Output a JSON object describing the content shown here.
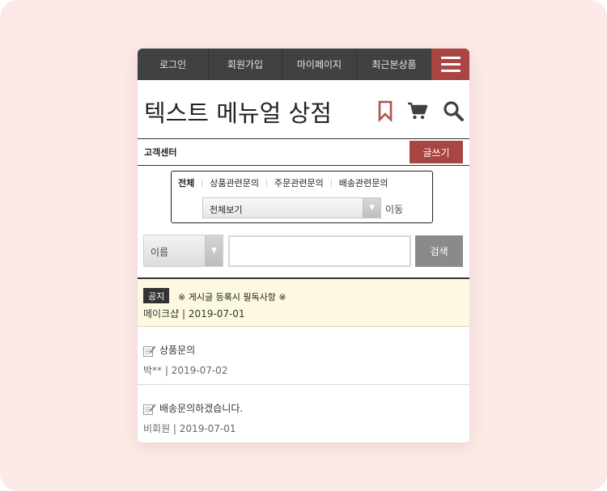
{
  "topnav": {
    "items": [
      "로그인",
      "회원가입",
      "마이페이지",
      "최근본상품"
    ]
  },
  "header": {
    "shop_title": "텍스트 메뉴얼 상점",
    "icons": [
      "bookmark-icon",
      "cart-icon",
      "search-icon"
    ],
    "accent_color": "#a94543"
  },
  "board": {
    "section_label": "고객센터",
    "write_label": "글쓰기",
    "categories": [
      "전체",
      "상품관련문의",
      "주문관련문의",
      "배송관련문의"
    ],
    "board_select": "전체보기",
    "move_label": "이동"
  },
  "search": {
    "field_value": "이름",
    "query": "",
    "button_label": "검색"
  },
  "notice": {
    "badge": "공지",
    "title": "※ 게시글 등록시 필독사항 ※",
    "meta": "메이크샵 | 2019-07-01"
  },
  "posts": [
    {
      "title": "상품문의",
      "meta": "박** | 2019-07-02"
    },
    {
      "title": "배송문의하겠습니다.",
      "meta": "비회원 | 2019-07-01"
    }
  ]
}
